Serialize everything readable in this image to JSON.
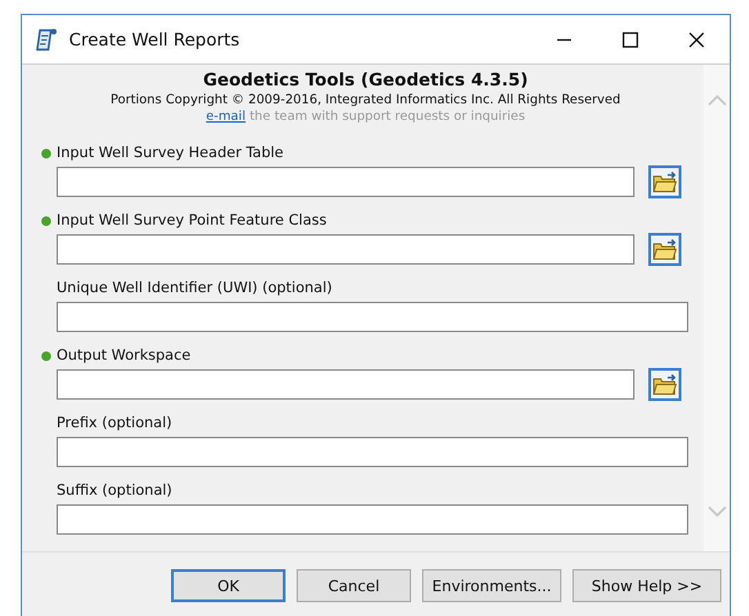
{
  "window": {
    "title": "Create Well Reports"
  },
  "header": {
    "title": "Geodetics Tools (Geodetics 4.3.5)",
    "copyright": "Portions Copyright © 2009-2016, Integrated Informatics Inc. All Rights Reserved",
    "link": "e-mail",
    "link_text": " the team with support requests or inquiries"
  },
  "parameters": [
    {
      "label": "Input Well Survey Header Table",
      "required": true,
      "browse": true
    },
    {
      "label": "Input Well Survey Point Feature Class",
      "required": true,
      "browse": true
    },
    {
      "label": "Unique Well Identifier (UWI) (optional)",
      "required": false,
      "browse": false
    },
    {
      "label": "Output Workspace",
      "required": true,
      "browse": true
    },
    {
      "label": "Prefix (optional)",
      "required": false,
      "browse": false
    },
    {
      "label": "Suffix (optional)",
      "required": false,
      "browse": false
    }
  ],
  "buttons": [
    {
      "label": "OK",
      "default": true
    },
    {
      "label": "Cancel",
      "default": false
    },
    {
      "label": "Environments...",
      "default": false
    },
    {
      "label": "Show Help >>",
      "default": false
    }
  ]
}
